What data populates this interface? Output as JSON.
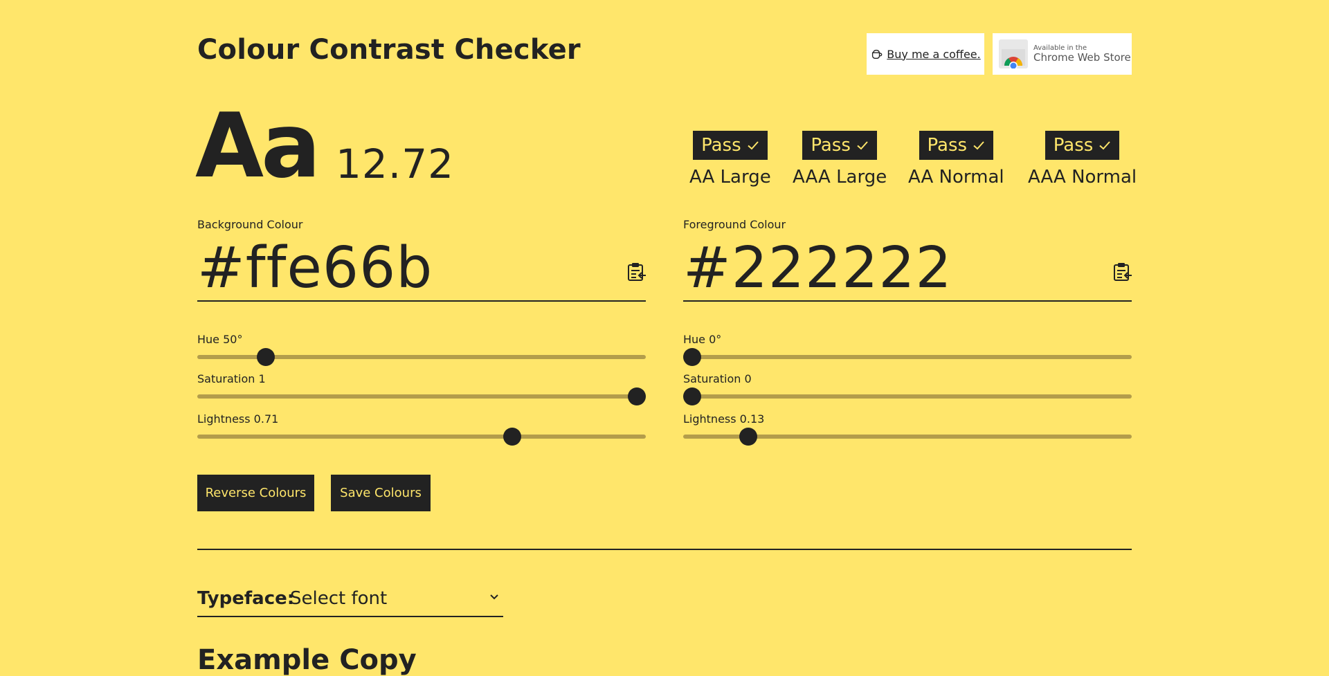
{
  "header": {
    "title": "Colour Contrast Checker",
    "coffee_label": "Buy me a coffee.",
    "webstore_small": "Available in the",
    "webstore_big": "Chrome Web Store"
  },
  "sample": {
    "text": "Aa",
    "ratio": "12.72"
  },
  "results": [
    {
      "status": "Pass",
      "label": "AA Large"
    },
    {
      "status": "Pass",
      "label": "AAA Large"
    },
    {
      "status": "Pass",
      "label": "AA Normal"
    },
    {
      "status": "Pass",
      "label": "AAA Normal"
    }
  ],
  "background": {
    "label": "Background Colour",
    "hex": "#ffe66b",
    "hue_label": "Hue 50°",
    "hue": 50,
    "saturation_label": "Saturation 1",
    "saturation": 1,
    "lightness_label": "Lightness 0.71",
    "lightness": 0.71
  },
  "foreground": {
    "label": "Foreground Colour",
    "hex": "#222222",
    "hue_label": "Hue 0°",
    "hue": 0,
    "saturation_label": "Saturation 0",
    "saturation": 0,
    "lightness_label": "Lightness 0.13",
    "lightness": 0.13
  },
  "actions": {
    "reverse_label": "Reverse Colours",
    "save_label": "Save Colours"
  },
  "typeface": {
    "label": "Typeface:",
    "selected": "Select font"
  },
  "example": {
    "title": "Example Copy"
  },
  "colors": {
    "background": "#ffe66b",
    "foreground": "#222222",
    "track": "#b39d4b"
  },
  "icons": {
    "coffee": "coffee-cup-icon",
    "check": "check-icon",
    "clipboard": "clipboard-paste-icon",
    "chevron": "chevron-down-icon",
    "store": "chrome-web-store-icon"
  }
}
